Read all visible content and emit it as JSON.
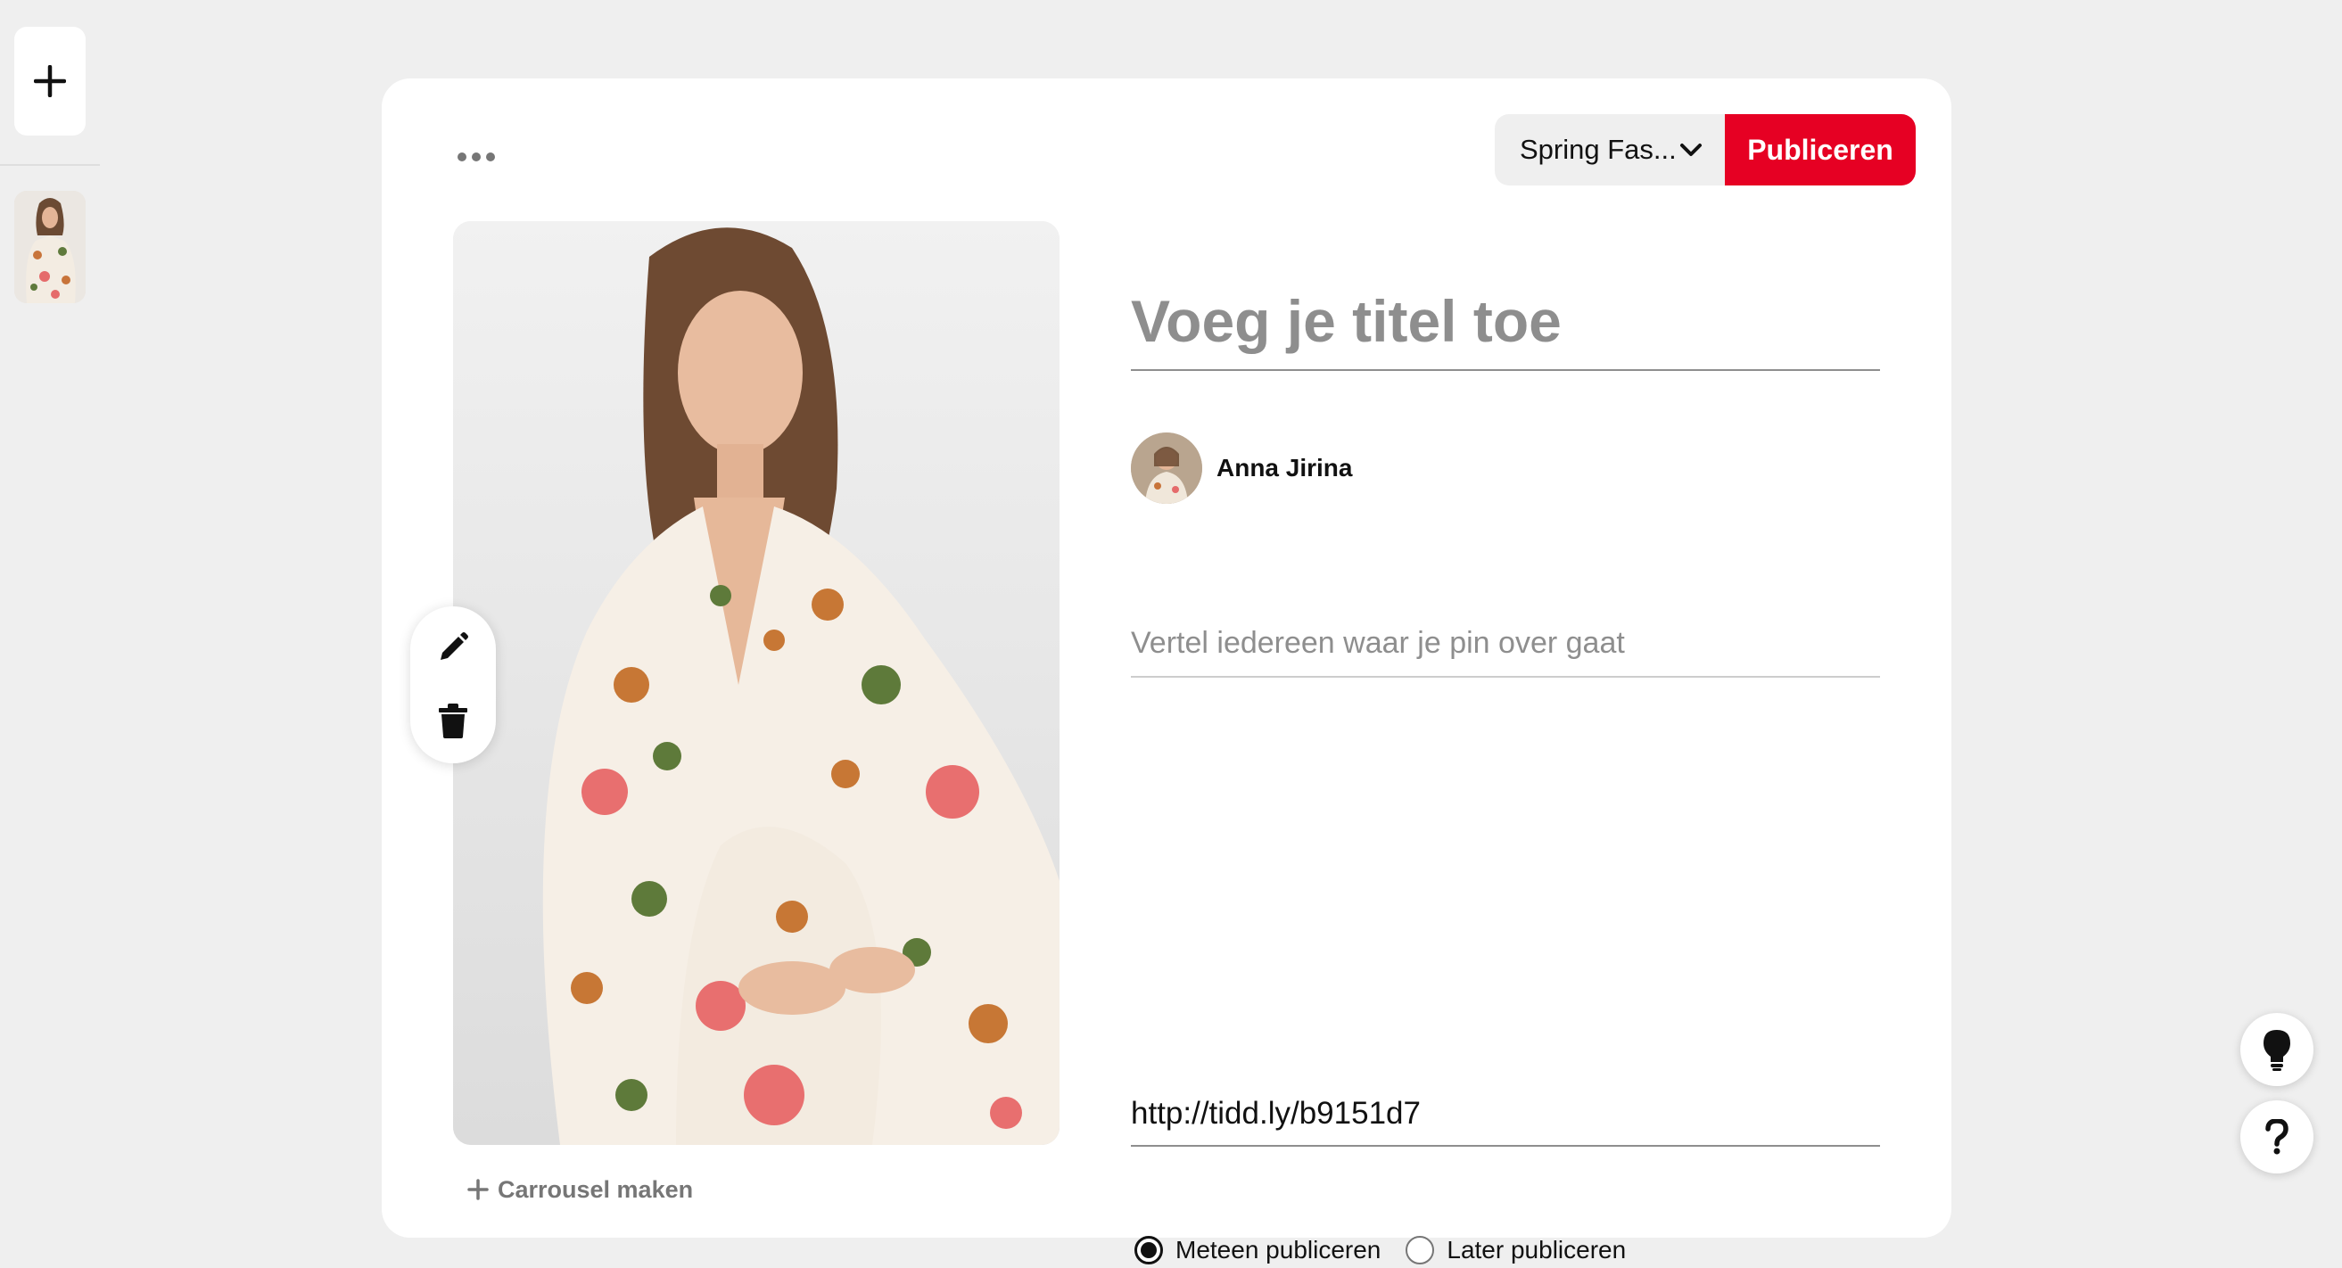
{
  "left_rail": {
    "add_icon": "plus-icon",
    "thumbnail_alt": "pin-thumbnail"
  },
  "toolbar": {
    "more_icon": "more-horizontal-icon",
    "board_name": "Spring Fas...",
    "board_chevron_icon": "chevron-down-icon",
    "publish_label": "Publiceren",
    "publish_color": "#e60023"
  },
  "editor": {
    "edit_icon": "pencil-icon",
    "delete_icon": "trash-icon",
    "carousel_label": "Carrousel maken",
    "title_placeholder": "Voeg je titel toe",
    "title_value": "",
    "author_name": "Anna Jirina",
    "description_placeholder": "Vertel iedereen waar je pin over gaat",
    "description_value": "",
    "link_value": "http://tidd.ly/b9151d7",
    "publish_options": [
      {
        "label": "Meteen publiceren",
        "checked": true
      },
      {
        "label": "Later publiceren",
        "checked": false
      }
    ]
  },
  "floating": {
    "tips_icon": "lightbulb-icon",
    "help_icon": "question-mark-icon"
  }
}
